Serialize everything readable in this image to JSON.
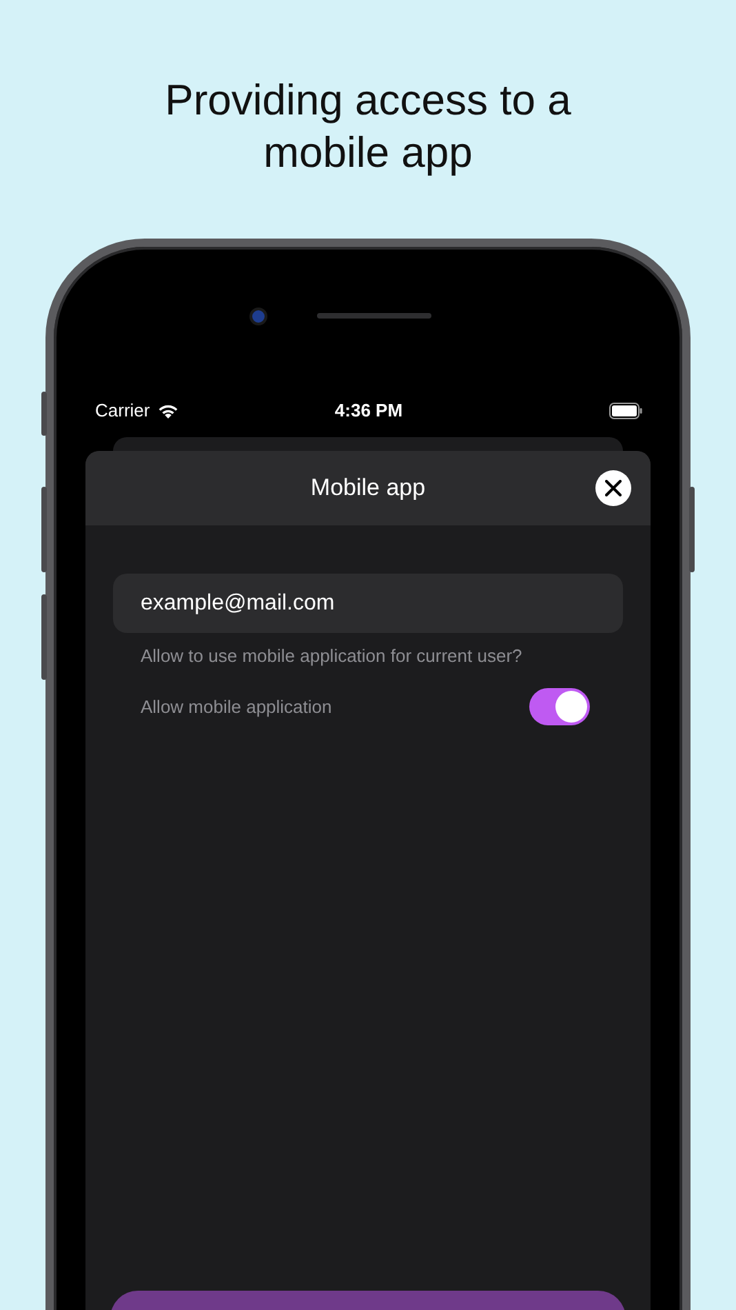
{
  "headline": "Providing access to a mobile app",
  "status_bar": {
    "carrier": "Carrier",
    "time": "4:36 PM"
  },
  "sheet": {
    "title": "Mobile app",
    "email_field": {
      "value": "example@mail.com"
    },
    "question": "Allow to use mobile application for current user?",
    "toggle": {
      "label": "Allow mobile application",
      "on": true
    }
  }
}
